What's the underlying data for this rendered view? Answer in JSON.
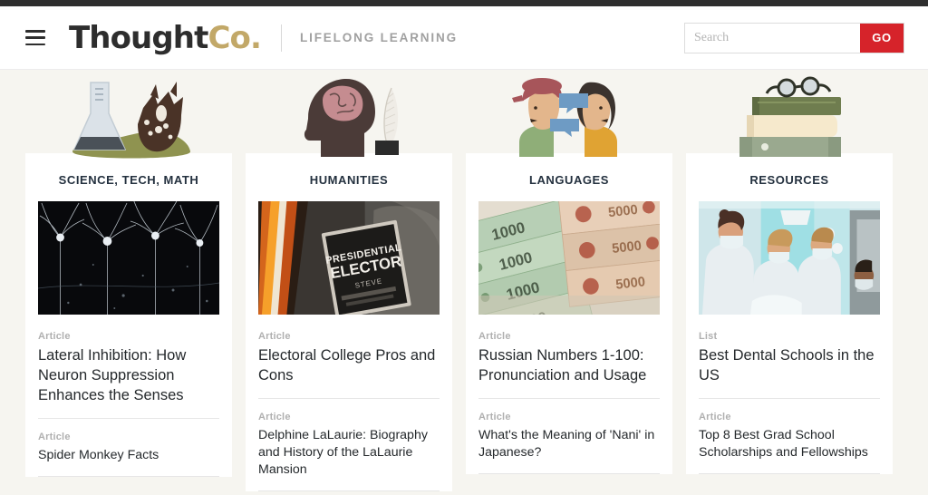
{
  "header": {
    "menu_icon": "hamburger-menu-icon",
    "logo_primary": "Thought",
    "logo_accent": "Co.",
    "tagline": "LIFELONG LEARNING",
    "accent_color": "#c2a868",
    "logo_color": "#2d2d2d",
    "search": {
      "placeholder": "Search",
      "value": "",
      "button_label": "GO",
      "button_color": "#d6232a"
    }
  },
  "page": {
    "background_color": "#f6f5f0",
    "topbar_color": "#2e2e2e"
  },
  "columns": [
    {
      "title": "SCIENCE, TECH, MATH",
      "illustration": "flask-and-deer-icon",
      "hero_image": "neuron-cells-microscope-photo",
      "items": [
        {
          "kicker": "Article",
          "headline": "Lateral Inhibition: How Neuron Suppression Enhances the Senses",
          "size": "large"
        },
        {
          "kicker": "Article",
          "headline": "Spider Monkey Facts",
          "size": "small"
        }
      ]
    },
    {
      "title": "HUMANITIES",
      "illustration": "head-with-brain-and-quill-icon",
      "hero_image": "presidential-elector-badge-photo",
      "items": [
        {
          "kicker": "Article",
          "headline": "Electoral College Pros and Cons",
          "size": "large"
        },
        {
          "kicker": "Article",
          "headline": "Delphine LaLaurie: Biography and History of the LaLaurie Mansion",
          "size": "small"
        }
      ]
    },
    {
      "title": "LANGUAGES",
      "illustration": "two-people-speech-bubbles-icon",
      "hero_image": "russian-ruble-banknotes-photo",
      "items": [
        {
          "kicker": "Article",
          "headline": "Russian Numbers 1-100: Pronunciation and Usage",
          "size": "large"
        },
        {
          "kicker": "Article",
          "headline": "What's the Meaning of 'Nani' in Japanese?",
          "size": "small"
        }
      ]
    },
    {
      "title": "RESOURCES",
      "illustration": "stacked-books-with-glasses-icon",
      "hero_image": "dental-students-clinic-photo",
      "items": [
        {
          "kicker": "List",
          "headline": "Best Dental Schools in the US",
          "size": "large"
        },
        {
          "kicker": "Article",
          "headline": "Top 8 Best Grad School Scholarships and Fellowships",
          "size": "small"
        }
      ]
    }
  ]
}
